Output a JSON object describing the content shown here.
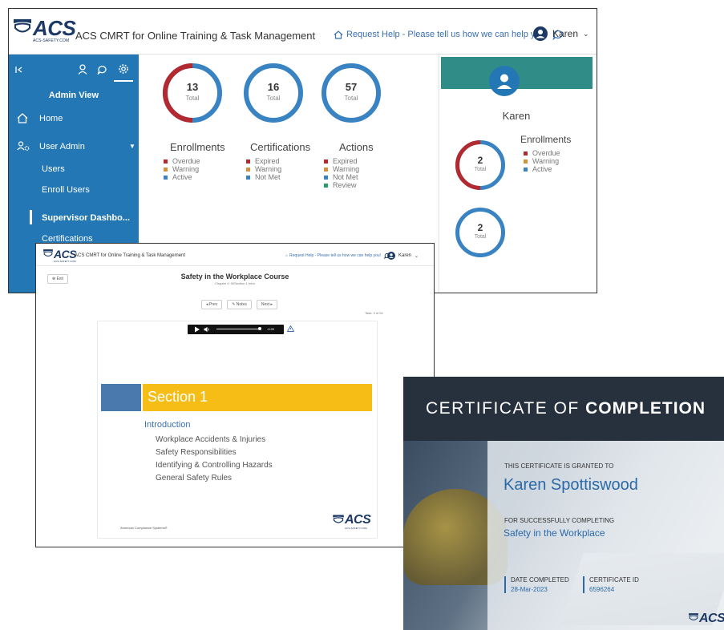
{
  "dashboard": {
    "logo": {
      "text": "ACS",
      "sub": "ACS-SAFETY.COM"
    },
    "app_title": "ACS CMRT for Online Training & Task Management",
    "help_link": "Request Help - Please tell us how we can help you!",
    "user_name": "Karen",
    "sidebar": {
      "view_label": "Admin View",
      "items": [
        {
          "label": "Home"
        },
        {
          "label": "User Admin"
        },
        {
          "label": "Users"
        },
        {
          "label": "Enroll Users"
        },
        {
          "label": "Supervisor Dashbo..."
        },
        {
          "label": "Certifications"
        }
      ]
    },
    "colors": {
      "sidebar": "#2377b5",
      "ring_blue": "#3a83c3",
      "ring_red": "#b22a30",
      "band": "#2f8c87"
    },
    "donuts": [
      {
        "value": "13",
        "label": "Total",
        "red_fraction": 0.5
      },
      {
        "value": "16",
        "label": "Total",
        "red_fraction": 0
      },
      {
        "value": "57",
        "label": "Total",
        "red_fraction": 0
      }
    ],
    "charts": [
      {
        "title": "Enrollments",
        "legend": [
          "Overdue",
          "Warning",
          "Active"
        ]
      },
      {
        "title": "Certifications",
        "legend": [
          "Expired",
          "Warning",
          "Not Met"
        ]
      },
      {
        "title": "Actions",
        "legend": [
          "Expired",
          "Warning",
          "Not Met",
          "Review"
        ]
      }
    ],
    "profile": {
      "name": "Karen",
      "enrollments_title": "Enrollments",
      "legend": [
        "Overdue",
        "Warning",
        "Active"
      ],
      "donuts": [
        {
          "value": "2",
          "label": "Total",
          "red_fraction": 0.5
        },
        {
          "value": "2",
          "label": "Total",
          "red_fraction": 0
        }
      ]
    },
    "legend_colors": {
      "Overdue": "#b22a30",
      "Expired": "#b22a30",
      "Warning": "#d4913a",
      "Active": "#3a83c3",
      "Not Met": "#3a83c3",
      "Review": "#2a9a6a"
    }
  },
  "course": {
    "logo": {
      "text": "ACS",
      "sub": "ACS-SAFETY.COM"
    },
    "app_title": "ACS CMRT for Online Training & Task Management",
    "help_link": "Request Help - Please tell us how we can help you!",
    "user_name": "Karen",
    "exit_label": "Exit",
    "title": "Safety in the Workplace Course",
    "subtitle": "Chapter 0: 00Section 1 Intro",
    "nav": {
      "prev": "Prev",
      "notes": "Notes",
      "next": "Next"
    },
    "task_count": "Task: 3 of 94",
    "audio_time": "-0:00",
    "slide": {
      "section": "Section 1",
      "intro": "Introduction",
      "bullets": [
        "Workplace Accidents & Injuries",
        "Safety Responsibilities",
        "Identifying & Controlling Hazards",
        "General Safety Rules"
      ],
      "footer": "American Compliance Systems®",
      "logo_text": "ACS",
      "logo_sub": "ACS-SAFETY.COM"
    }
  },
  "certificate": {
    "heading_light": "CERTIFICATE OF ",
    "heading_bold": "COMPLETION",
    "granted_to": "THIS CERTIFICATE IS GRANTED TO",
    "recipient": "Karen Spottiswood",
    "for_label": "FOR SUCCESSFULLY COMPLETING",
    "course": "Safety in the Workplace",
    "date_label": "DATE COMPLETED",
    "date_value": "28-Mar-2023",
    "id_label": "CERTIFICATE ID",
    "id_value": "6596264",
    "logo_text": "ACS"
  }
}
